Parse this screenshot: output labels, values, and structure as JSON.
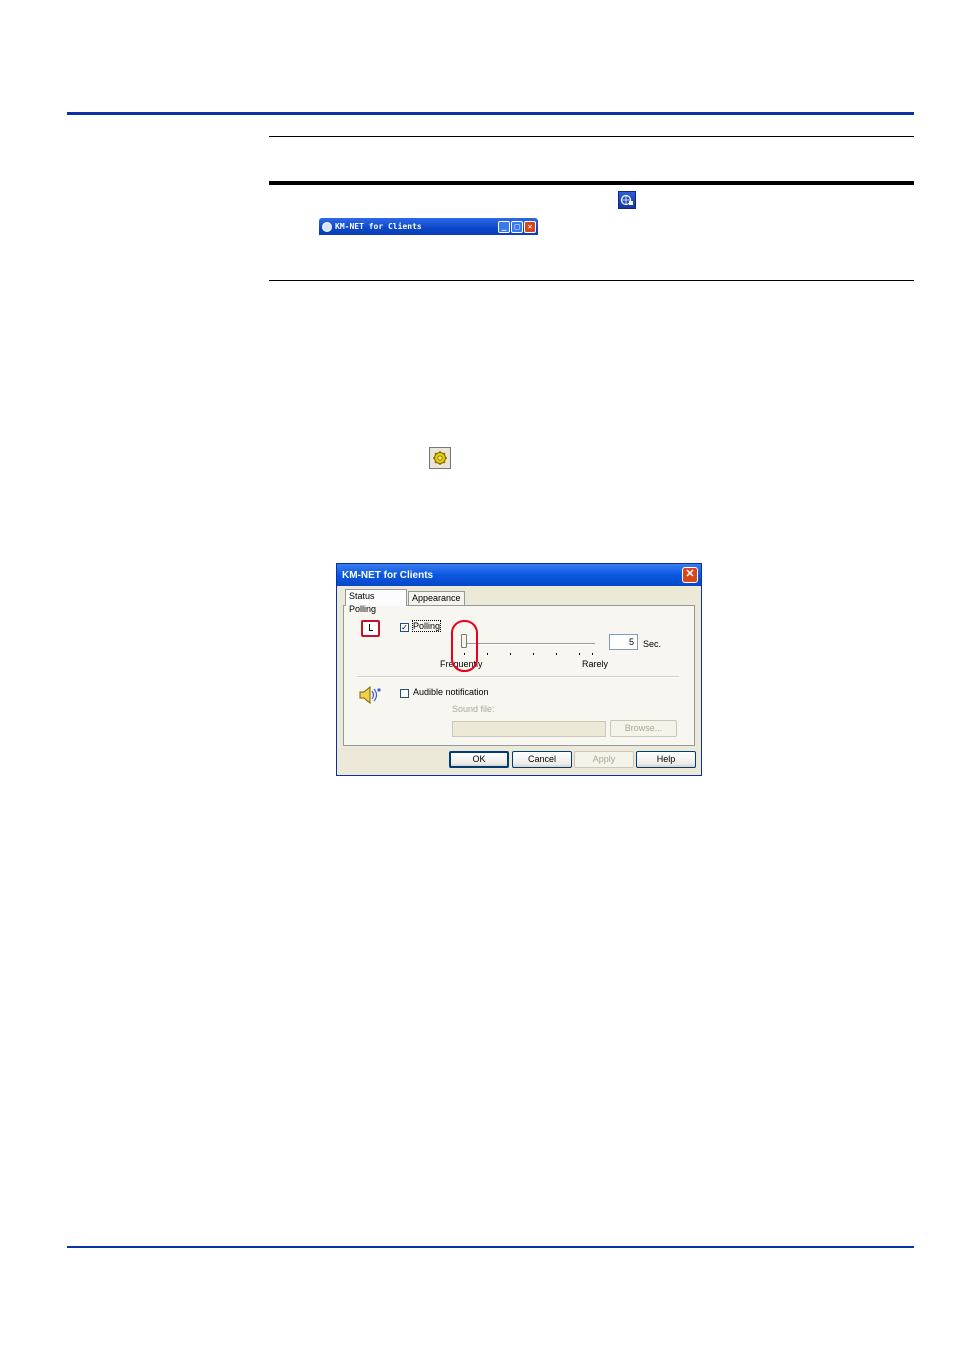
{
  "mini_window": {
    "title": "KM-NET for Clients",
    "minimize": "_",
    "maximize": "□",
    "close": "✕"
  },
  "dialog": {
    "title": "KM-NET for Clients",
    "close": "✕",
    "tabs": [
      "Status Polling",
      "Appearance"
    ],
    "polling_label": "Polling",
    "polling_checked": "✓",
    "polling_interval": "5",
    "interval_unit": "Sec.",
    "slider_min_label": "Frequently",
    "slider_max_label": "Rarely",
    "audible_label": "Audible notification",
    "sound_file_label": "Sound file:",
    "browse_label": "Browse...",
    "buttons": {
      "ok": "OK",
      "cancel": "Cancel",
      "apply": "Apply",
      "help": "Help"
    }
  }
}
